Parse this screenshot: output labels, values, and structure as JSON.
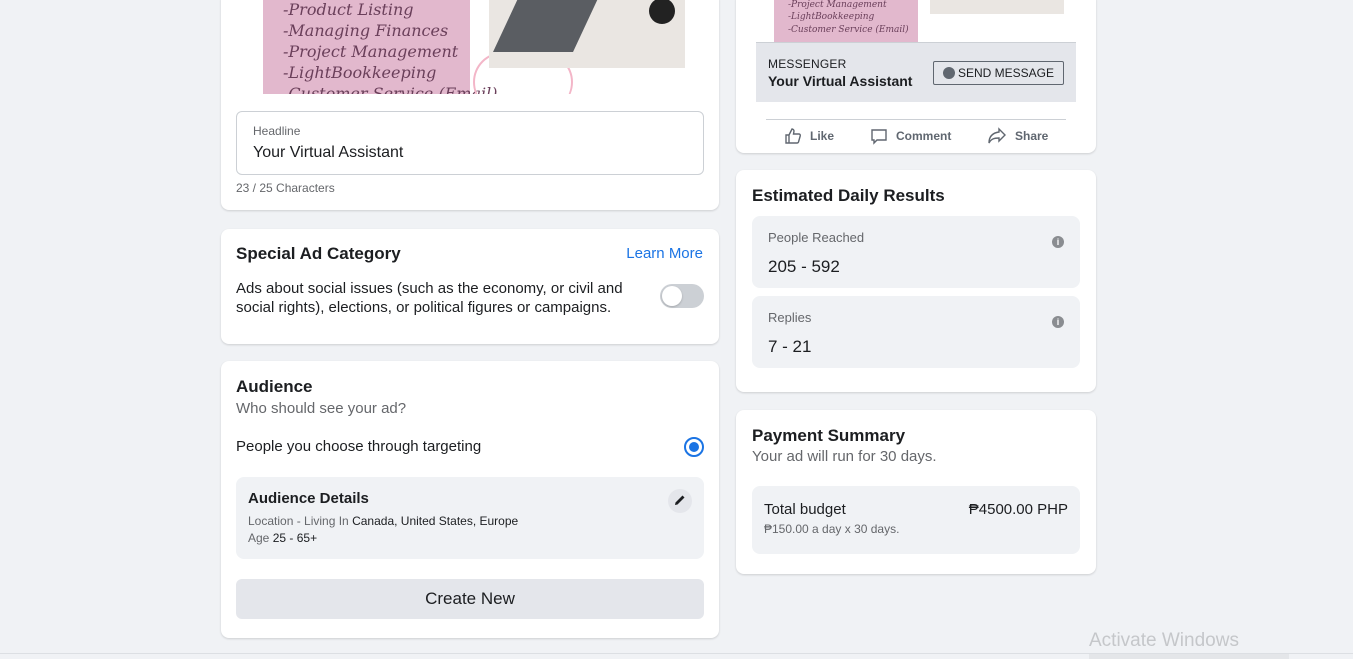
{
  "creative": {
    "image_lines": [
      "-Product Listing",
      "-Managing Finances",
      "-Project Management",
      "-LightBookkeeping",
      "-Customer Service (Email)"
    ],
    "headline_label": "Headline",
    "headline_value": "Your Virtual Assistant",
    "char_count": "23 / 25 Characters"
  },
  "special_ad": {
    "title": "Special Ad Category",
    "learn_more": "Learn More",
    "description": "Ads about social issues (such as the economy, or civil and social rights), elections, or political figures or campaigns.",
    "toggle_on": false
  },
  "audience": {
    "title": "Audience",
    "subtitle": "Who should see your ad?",
    "option_label": "People you choose through targeting",
    "option_selected": true,
    "details_title": "Audience Details",
    "location_label": "Location - Living In",
    "location_value": "Canada, United States, Europe",
    "age_label": "Age",
    "age_value": "25 - 65+",
    "create_button": "Create New"
  },
  "preview": {
    "image_lines": [
      "-Project Management",
      "-LightBookkeeping",
      "-Customer Service (Email)"
    ],
    "messenger_label": "MESSENGER",
    "page_name": "Your Virtual Assistant",
    "send_button": "SEND MESSAGE",
    "actions": {
      "like": "Like",
      "comment": "Comment",
      "share": "Share"
    }
  },
  "estimated": {
    "title": "Estimated Daily Results",
    "stats": [
      {
        "label": "People Reached",
        "value": "205 - 592"
      },
      {
        "label": "Replies",
        "value": "7 - 21"
      }
    ]
  },
  "payment": {
    "title": "Payment Summary",
    "subtitle": "Your ad will run for 30 days.",
    "budget_label": "Total budget",
    "budget_amount": "₱4500.00 PHP",
    "budget_detail": "₱150.00 a day x 30 days."
  },
  "watermark": "Activate Windows",
  "colors": {
    "accent": "#1b74e4",
    "background": "#f0f2f5"
  }
}
